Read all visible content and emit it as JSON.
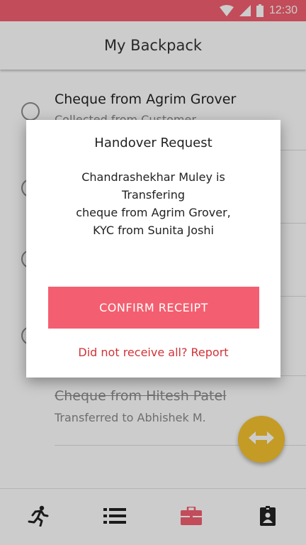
{
  "colors": {
    "accent": "#f35f70",
    "fab": "#f6c22f",
    "report_link": "#d23237",
    "active_nav": "#f35f70"
  },
  "status_bar": {
    "time": "12:30",
    "icons": [
      "wifi-icon",
      "signal-icon",
      "battery-icon"
    ]
  },
  "header": {
    "title": "My Backpack"
  },
  "list": {
    "items": [
      {
        "title": "Cheque from Agrim Grover",
        "subtitle": "Collected from Customer",
        "struck": false
      },
      {
        "title": "",
        "subtitle": "",
        "struck": false
      },
      {
        "title": "",
        "subtitle": "",
        "struck": false
      },
      {
        "title": "",
        "subtitle": "",
        "struck": false
      },
      {
        "title": "Cheque from Hitesh Patel",
        "subtitle": "Transferred to Abhishek M.",
        "struck": true
      }
    ]
  },
  "fab": {
    "icon": "swap-horizontal-icon"
  },
  "bottom_nav": {
    "items": [
      {
        "icon": "runner-icon",
        "active": false
      },
      {
        "icon": "list-icon",
        "active": false
      },
      {
        "icon": "briefcase-icon",
        "active": true
      },
      {
        "icon": "id-badge-icon",
        "active": false
      }
    ]
  },
  "dialog": {
    "title": "Handover Request",
    "message_lines": [
      "Chandrashekhar Muley is",
      "Transfering",
      "cheque from Agrim Grover,",
      "KYC from Sunita Joshi"
    ],
    "confirm_label": "CONFIRM RECEIPT",
    "report_label": "Did not receive all? Report"
  }
}
